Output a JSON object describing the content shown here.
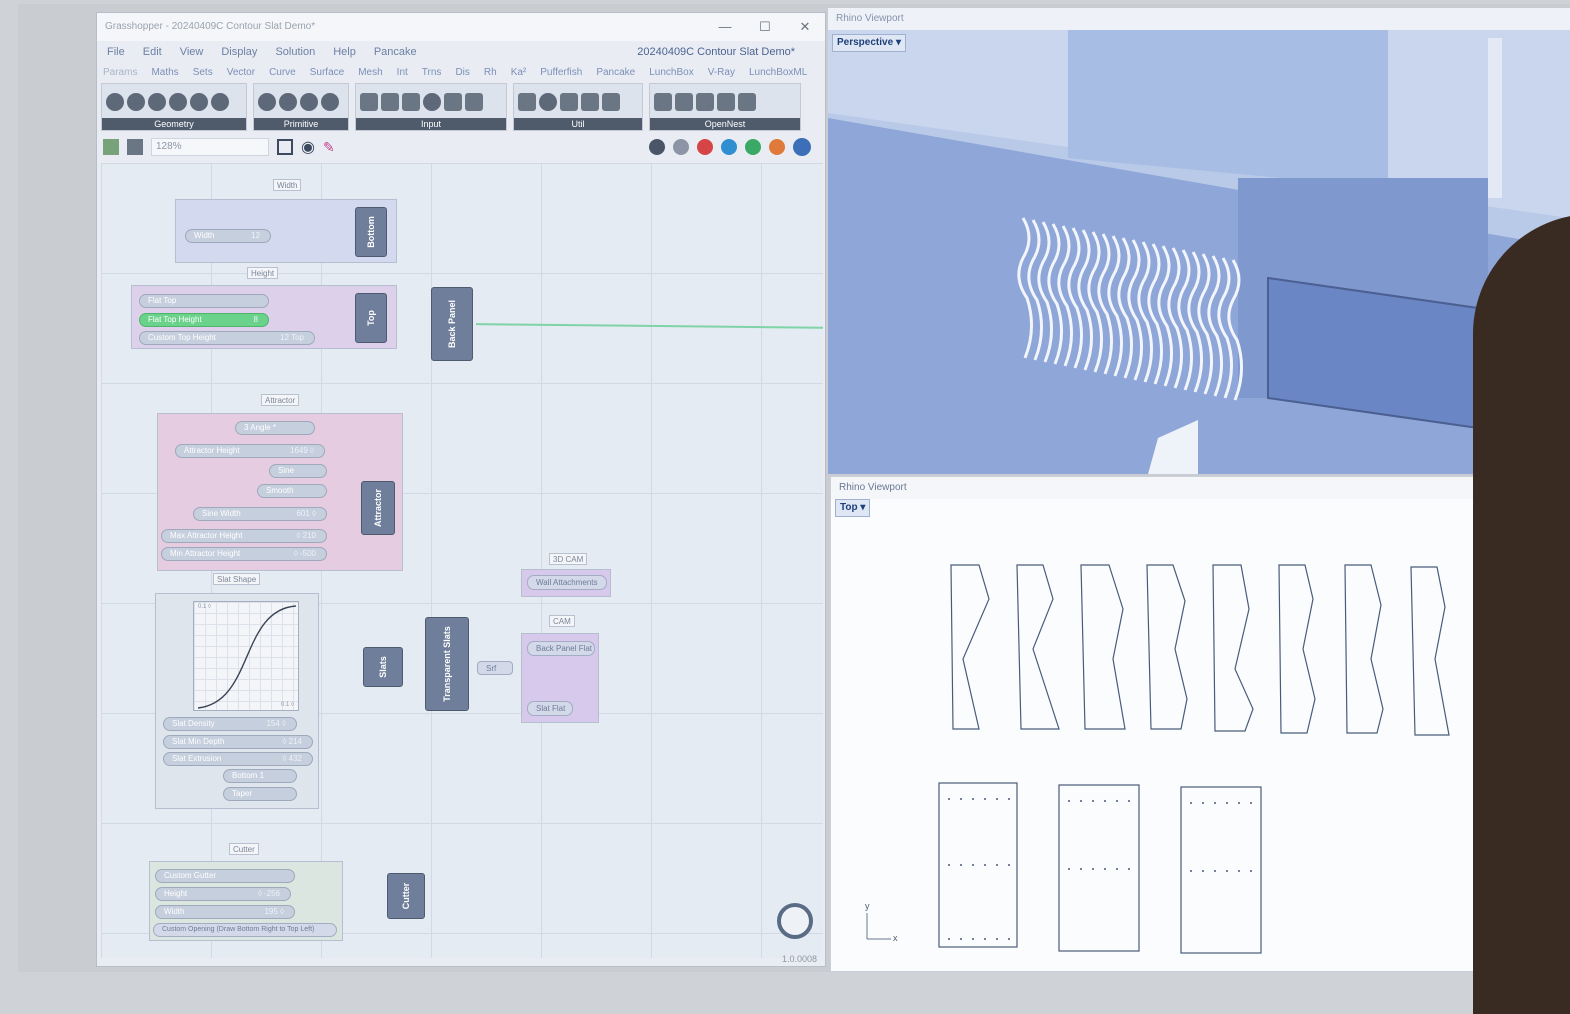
{
  "grasshopper": {
    "title": "Grasshopper - 20240409C Contour Slat Demo*",
    "window_controls": [
      "—",
      "☐",
      "✕"
    ],
    "menu": [
      "File",
      "Edit",
      "View",
      "Display",
      "Solution",
      "Help",
      "Pancake"
    ],
    "document_name": "20240409C Contour Slat Demo*",
    "tabs": [
      "Params",
      "Maths",
      "Sets",
      "Vector",
      "Curve",
      "Surface",
      "Mesh",
      "Int",
      "Trns",
      "Dis",
      "Rh",
      "Ka²",
      "Pufferfish",
      "Pancake",
      "LunchBox",
      "V-Ray",
      "LunchBoxML"
    ],
    "ribbon_groups": [
      "Geometry",
      "Primitive",
      "Input",
      "Util",
      "OpenNest"
    ],
    "zoom": "128%",
    "status_version": "1.0.0008",
    "canvas": {
      "groups": {
        "width": "Width",
        "height": "Height",
        "attractor": "Attractor",
        "slat_shape": "Slat Shape",
        "cutter": "Cutter",
        "cam3d": "3D CAM",
        "cam": "CAM"
      },
      "sliders": {
        "width": {
          "label": "Width",
          "value": "12"
        },
        "flat_top": {
          "label": "Flat Top",
          "value": ""
        },
        "flat_top_height": {
          "label": "Flat Top Height",
          "value": "8"
        },
        "custom_top_height": {
          "label": "Custom Top Height",
          "value": "12 Top"
        },
        "angle": {
          "label": "3 Angle *",
          "value": ""
        },
        "attractor_height": {
          "label": "Attractor Height",
          "value": "1649 ◊"
        },
        "sine": {
          "label": "Sine",
          "value": ""
        },
        "smooth": {
          "label": "Smooth",
          "value": ""
        },
        "sine_width": {
          "label": "Sine Width",
          "value": "601 ◊"
        },
        "max_attractor_height": {
          "label": "Max Attractor Height",
          "value": "◊ 210"
        },
        "min_attractor_height": {
          "label": "Min Attractor Height",
          "value": "◊ -500"
        },
        "slat_density": {
          "label": "Slat Density",
          "value": "154 ◊"
        },
        "slat_min_depth": {
          "label": "Slat Min Depth",
          "value": "◊ 214"
        },
        "slat_extrusion": {
          "label": "Slat Extrusion",
          "value": "◊ 432"
        },
        "bottom": {
          "label": "Bottom 1",
          "value": ""
        },
        "taper": {
          "label": "Taper",
          "value": ""
        },
        "custom_gutter": {
          "label": "Custom Gutter",
          "value": ""
        },
        "gutter_height": {
          "label": "Height",
          "value": "◊ -256"
        },
        "gutter_width": {
          "label": "Width",
          "value": "195 ◊"
        },
        "custom_opening": {
          "label": "Custom Opening (Draw Bottom Right to Top Left)",
          "value": ""
        }
      },
      "components": {
        "bottom": "Bottom",
        "top": "Top",
        "back_panel": "Back Panel",
        "attractor": "Attractor",
        "slats": "Slats",
        "transparent_slats": "Transparent Slats",
        "cutter": "Cutter",
        "srf": "Srf"
      },
      "panels": {
        "wall_attachments": "Wall Attachments",
        "back_panel_flat": "Back Panel Flat",
        "slat_flat": "Slat Flat"
      },
      "graph_labels": {
        "top": "0.1 ◊",
        "bottom": "0.1 ◊"
      }
    }
  },
  "rhino": {
    "perspective": {
      "header": "Rhino Viewport",
      "view": "Perspective",
      "arrow": "▾"
    },
    "top": {
      "header": "Rhino Viewport",
      "view": "Top",
      "arrow": "▾",
      "axis_y": "y",
      "axis_x": "x"
    }
  },
  "colors": {
    "accent_blue": "#3d6fb8",
    "wire_green": "#7fd3a6",
    "group_pink": "#e8c9df",
    "group_purple": "#d6c9ec"
  }
}
